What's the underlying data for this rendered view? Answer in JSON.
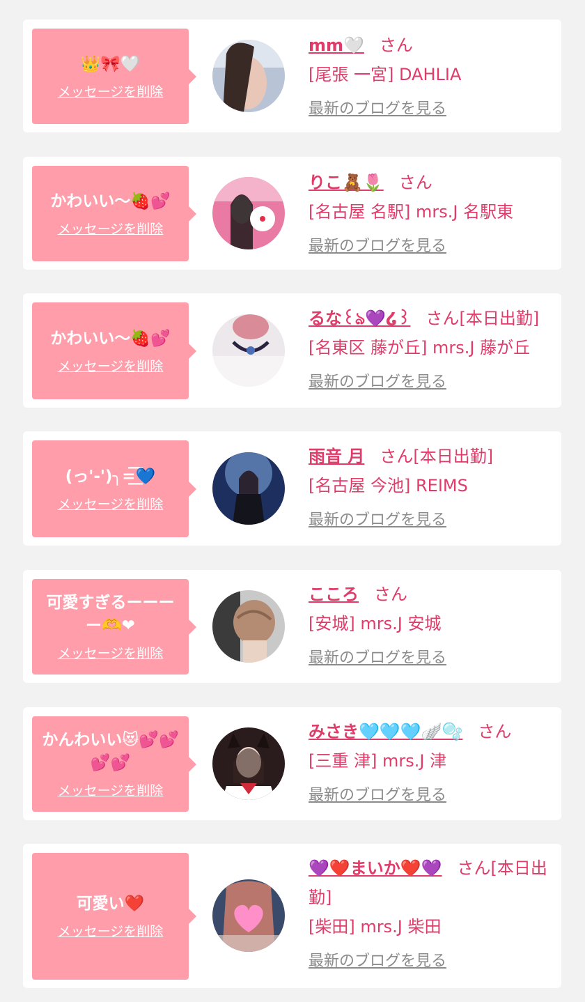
{
  "colors": {
    "accent": "#e03c6a",
    "bubble": "#ff9eaa",
    "link_gray": "#8b8b8b",
    "background": "#f2f2f2"
  },
  "delete_label": "メッセージを削除",
  "blog_label": "最新のブログを見る",
  "san_label": "さん",
  "messages": [
    {
      "message": "👑🎀🤍",
      "name": "mm🤍",
      "status": "",
      "shop": "[尾張 一宮] DAHLIA"
    },
    {
      "message": "かわいい〜🍓💕",
      "name": "りこ🧸🌷",
      "status": "",
      "shop": "[名古屋 名駅] mrs.J 名駅東"
    },
    {
      "message": "かわいい〜🍓💕",
      "name": "るな꒰ঌ💜໒꒱",
      "status": "[本日出勤]",
      "shop": "[名東区 藤が丘] mrs.J 藤が丘"
    },
    {
      "message": "(っ'-')╮=͟͟͞͞💙",
      "name": "雨音 月",
      "status": "[本日出勤]",
      "shop": "[名古屋 今池] REIMS"
    },
    {
      "message": "可愛すぎるーーーー🫶❤",
      "name": "こころ",
      "status": "",
      "shop": "[安城] mrs.J 安城"
    },
    {
      "message": "かんわいい😻💕💕💕💕",
      "name": "みさき🩵🩵🩵🪽🫧",
      "status": "",
      "shop": "[三重 津] mrs.J 津"
    },
    {
      "message": "可愛い❤️",
      "name": "💜❤️まいか❤️💜",
      "status": "[本日出勤]",
      "shop": "[柴田] mrs.J 柴田"
    }
  ]
}
